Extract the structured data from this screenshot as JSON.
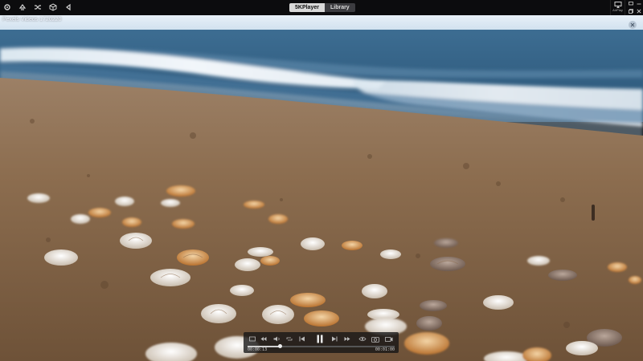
{
  "toolbar": {
    "icons": [
      "settings-icon",
      "recycle-icon",
      "shuffle-icon",
      "cube-icon",
      "back-icon"
    ]
  },
  "tabs": [
    {
      "label": "5KPlayer",
      "active": true
    },
    {
      "label": "Library",
      "active": false
    }
  ],
  "airplay": {
    "label": "AirPlay"
  },
  "window_controls": [
    "chat-icon",
    "minimize-icon",
    "restore-icon",
    "close-icon"
  ],
  "video": {
    "title": "Pexels Videos 1720220"
  },
  "player": {
    "current_time": "00:00:13",
    "total_time": "00:01:00",
    "progress": 0.22,
    "volume": 0.6,
    "state": "playing"
  },
  "colors": {
    "sky": "#dbe7f2",
    "sea": "#2f5f85",
    "sand": "#87684a",
    "bar": "#0c0c0e"
  }
}
